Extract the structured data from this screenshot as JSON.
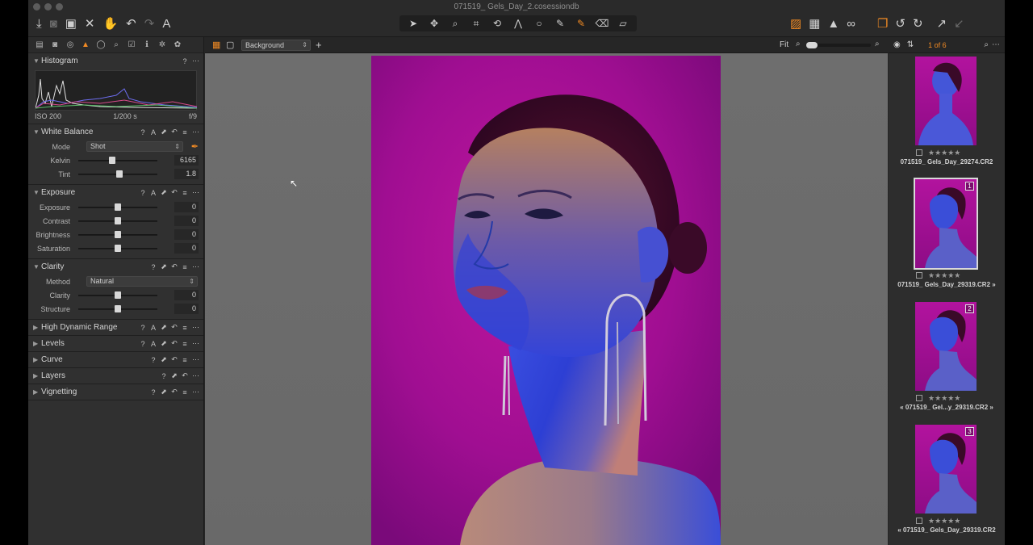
{
  "window": {
    "title": "071519_ Gels_Day_2.cosessiondb"
  },
  "toolbar": {
    "left_icons": [
      "import-icon",
      "camera-icon",
      "batch-icon",
      "delete-icon",
      "undo-icon",
      "undo-back-icon",
      "redo-icon",
      "text-icon"
    ],
    "cursor_tools": [
      "cursor-icon",
      "pan-icon",
      "loupe-icon",
      "crop-icon",
      "rotate-icon",
      "keystone-icon",
      "circle-icon",
      "brush-icon",
      "pen-icon",
      "eraser-icon",
      "gradient-icon"
    ],
    "right_icons": [
      "edit-mask-icon",
      "grid-icon",
      "warning-icon",
      "proof-icon",
      "layers-icon",
      "rotate-left-icon",
      "rotate-right-icon",
      "expand-icon",
      "collapse-icon"
    ]
  },
  "left_panel": {
    "tabs": [
      "library",
      "capture",
      "color",
      "exposure",
      "lens",
      "details",
      "metadata",
      "adjustments",
      "output"
    ],
    "histogram": {
      "title": "Histogram",
      "iso": "ISO 200",
      "shutter": "1/200 s",
      "aperture": "f/9"
    },
    "white_balance": {
      "title": "White Balance",
      "mode_label": "Mode",
      "mode_value": "Shot",
      "kelvin_label": "Kelvin",
      "kelvin_value": "6165",
      "kelvin_pos": 0.42,
      "tint_label": "Tint",
      "tint_value": "1.8",
      "tint_pos": 0.52
    },
    "exposure": {
      "title": "Exposure",
      "sliders": [
        {
          "label": "Exposure",
          "value": "0",
          "pos": 0.5
        },
        {
          "label": "Contrast",
          "value": "0",
          "pos": 0.5
        },
        {
          "label": "Brightness",
          "value": "0",
          "pos": 0.5
        },
        {
          "label": "Saturation",
          "value": "0",
          "pos": 0.5
        }
      ]
    },
    "clarity": {
      "title": "Clarity",
      "method_label": "Method",
      "method_value": "Natural",
      "sliders": [
        {
          "label": "Clarity",
          "value": "0",
          "pos": 0.5
        },
        {
          "label": "Structure",
          "value": "0",
          "pos": 0.5
        }
      ]
    },
    "collapsed": [
      "High Dynamic Range",
      "Levels",
      "Curve",
      "Layers",
      "Vignetting"
    ]
  },
  "viewer": {
    "background_select": "Background",
    "zoom_label": "Fit"
  },
  "browser": {
    "counter": "1 of 6",
    "thumbnails": [
      {
        "name": "071519_ Gels_Day_29274.CR2",
        "badge": ""
      },
      {
        "name": "071519_ Gels_Day_29319.CR2",
        "badge": "1"
      },
      {
        "name": "071519_ Gel...y_29319.CR2",
        "badge": "2"
      },
      {
        "name": "071519_ Gels_Day_29319.CR2",
        "badge": "3"
      }
    ]
  },
  "colors": {
    "accent": "#f08a24",
    "backdrop": "#a30f94",
    "viewer_bg": "#6c6c6c"
  }
}
